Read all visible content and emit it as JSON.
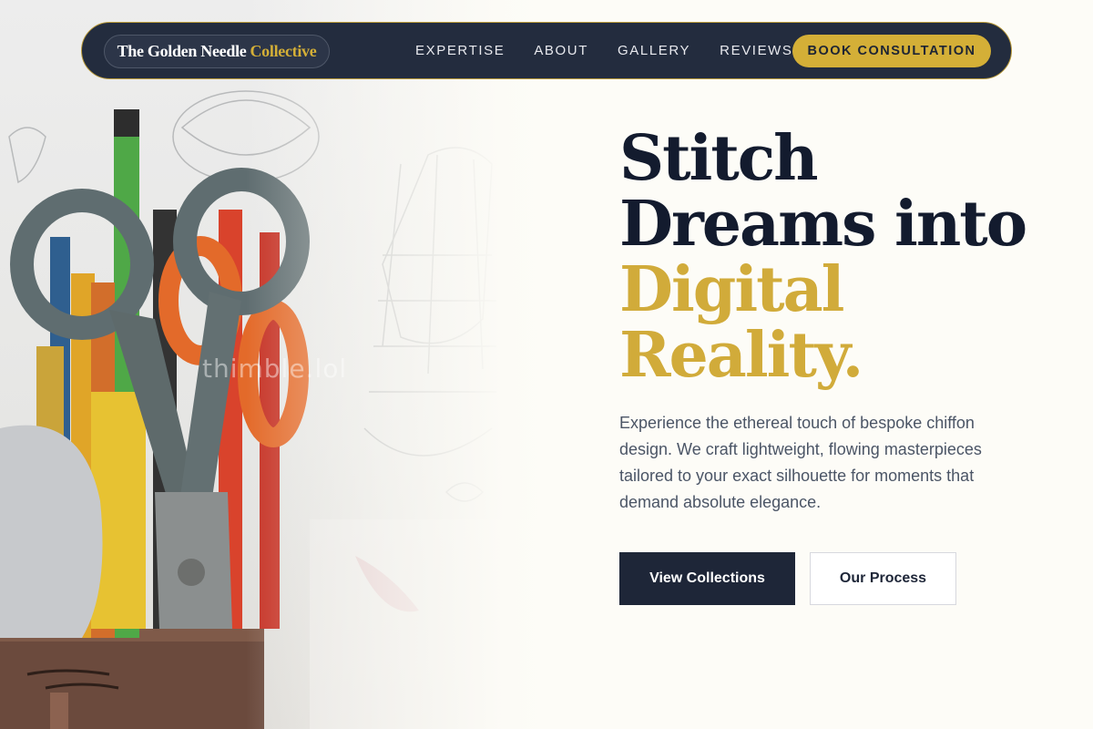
{
  "brand": {
    "name_main": "The Golden Needle",
    "name_accent": "Collective"
  },
  "nav": {
    "links": [
      "EXPERTISE",
      "ABOUT",
      "GALLERY",
      "REVIEWS"
    ],
    "cta_label": "BOOK CONSULTATION"
  },
  "hero": {
    "headline_line1": "Stitch",
    "headline_line2": "Dreams into",
    "headline_line3": "Digital",
    "headline_line4": "Reality.",
    "lead": "Experience the ethereal touch of bespoke chiffon design. We craft lightweight, flowing masterpieces tailored to your exact silhouette for moments that demand absolute elegance.",
    "primary_button": "View Collections",
    "secondary_button": "Our Process",
    "image_watermark": "thimble.lol"
  },
  "colors": {
    "navy": "#232c3e",
    "gold": "#d4af37",
    "headline_dark": "#131b2e",
    "body_text": "#4b5566",
    "background": "#fdfcf7"
  },
  "icons": [
    "scissors-icon",
    "pencil-icon"
  ]
}
